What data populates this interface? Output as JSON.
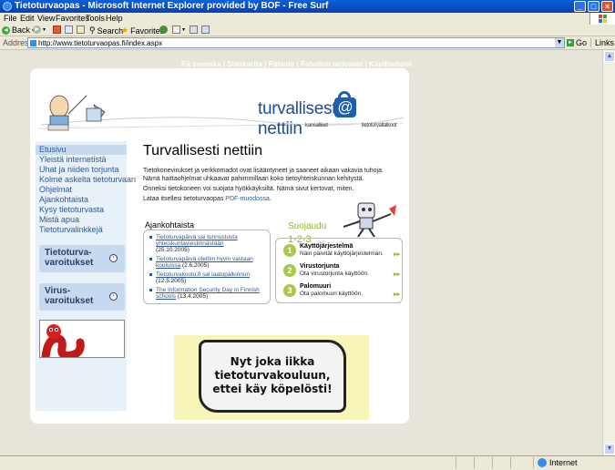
{
  "window": {
    "title": "Tietoturvaopas - Microsoft Internet Explorer provided by BOF - Free Surf",
    "buttons": [
      "_",
      "□",
      "×"
    ]
  },
  "menu": [
    "File",
    "Edit",
    "View",
    "Favorites",
    "Tools",
    "Help"
  ],
  "toolbar": {
    "back": "Back",
    "search": "Search",
    "favorites": "Favorites"
  },
  "address": {
    "label": "Address",
    "url": "http://www.tietoturvaopas.fi/index.aspx",
    "go": "Go",
    "links": "Links"
  },
  "status": {
    "zone": "Internet"
  },
  "page": {
    "top_links": [
      "På svenska",
      "Sivukartta",
      "Palaute",
      "Palvelun tarjoavat",
      "Käyttöehdot"
    ],
    "brand": {
      "part1": "turvallisesti",
      "part2": "nettiin",
      "sub1": "kansalliset",
      "sub2": "tietoturvaltalkoot"
    },
    "nav": [
      "Etusivu",
      "Yleistä internetistä",
      "Uhat ja niiden torjunta",
      "Kolme askelta tietoturvaan",
      "Ohjelmat",
      "Ajankohtaista",
      "Kysy tietoturvasta",
      "Mistä apua",
      "Tietoturvalinkkejä"
    ],
    "warnings": [
      {
        "line1": "Tietoturva-",
        "line2": "varoitukset"
      },
      {
        "line1": "Virus-",
        "line2": "varoitukset"
      }
    ],
    "title": "Turvallisesti nettiin",
    "intro": [
      "Tietokonevirukset ja verkkomadot ovat lisääntyneet ja saaneet aikaan vakavia tuhoja. Nämä haittaohjelmat uhkaavat pahimmillaan koko tietoyhteiskunnan kehitystä.",
      "Onneksi tietokoneen voi suojata hyökkäyksiltä. Nämä sivut kertovat, miten."
    ],
    "download": {
      "prefix": "Lataa itsellesi tietoturvaopas ",
      "link": "PDF-muodossa",
      "suffix": "."
    },
    "news": {
      "heading": "Ajankohtaista",
      "items": [
        {
          "title": "Tietoturvapäivä sai tunnustusta yhteiskuntaviestinnästään",
          "date": "(25.10.2005)"
        },
        {
          "title": "Tietoturvapäivä otettiin hyvin vastaan kouluissa",
          "date": "(2.6.2005)"
        },
        {
          "title": "Tietoturvakoulu.fi sai laatupalkinnon",
          "date": "(12.5.2005)"
        },
        {
          "title": "The Information Security Day in Finnish schools",
          "date": "(13.4.2005)"
        }
      ]
    },
    "protect": {
      "heading": "Suojaudu",
      "subheading": "1-2-3",
      "steps": [
        {
          "num": "1",
          "title": "Käyttöjärjestelmä",
          "desc": "Näin päivität käyttöjärjestelmän."
        },
        {
          "num": "2",
          "title": "Virustorjunta",
          "desc": "Ota virustorjunta käyttöön."
        },
        {
          "num": "3",
          "title": "Palomuuri",
          "desc": "Ota palomuuri käyttöön."
        }
      ],
      "arrow": "▸▸"
    },
    "ad": {
      "line1": "Nyt joka iikka",
      "line2": "tietoturvakouluun,",
      "line3": "ettei käy köpelösti!"
    }
  },
  "colors": {
    "title_bar": "#0A5FD8",
    "link": "#2C5A9C",
    "accent_green": "#8ABA2A",
    "brand_blue": "#1C4C9C"
  }
}
